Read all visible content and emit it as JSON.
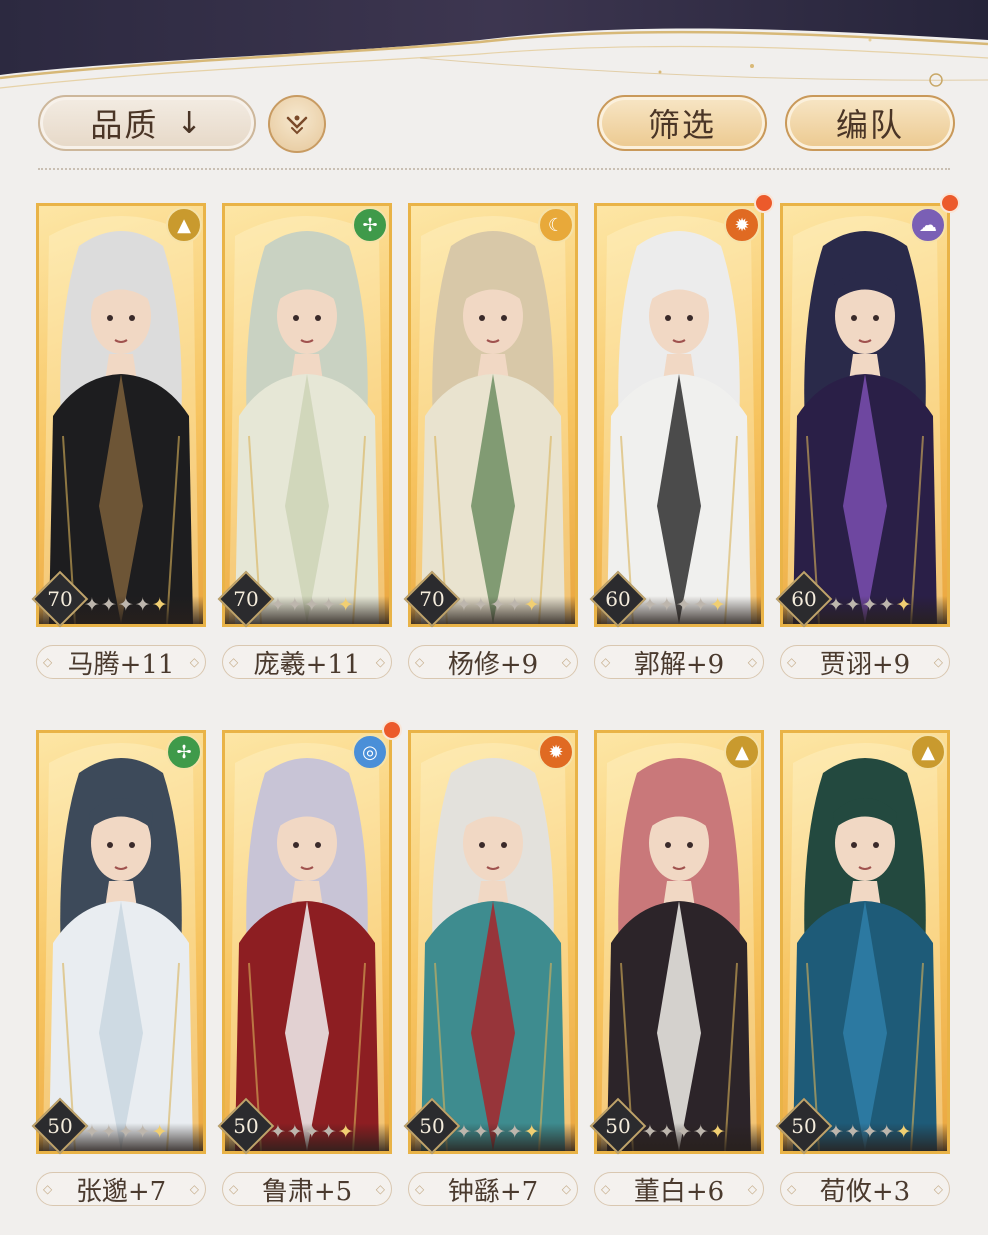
{
  "toolbar": {
    "sort_label": "品质",
    "sort_arrow": "↓",
    "filter_label": "筛选",
    "team_label": "编队"
  },
  "colors": {
    "background": "#f1efed",
    "card_gold": "#f7c460",
    "notification": "#ec5a2b"
  },
  "characters": [
    {
      "name": "马腾+11",
      "level": "70",
      "element": "earth-icon",
      "stars": 5,
      "notify": false
    },
    {
      "name": "庞羲+11",
      "level": "70",
      "element": "wind-icon",
      "stars": 5,
      "notify": false
    },
    {
      "name": "杨修+9",
      "level": "70",
      "element": "moon-icon",
      "stars": 5,
      "notify": false
    },
    {
      "name": "郭解+9",
      "level": "60",
      "element": "fire-icon",
      "stars": 5,
      "notify": true
    },
    {
      "name": "贾诩+9",
      "level": "60",
      "element": "cloud-icon",
      "stars": 5,
      "notify": true
    },
    {
      "name": "张邈+7",
      "level": "50",
      "element": "wind-icon",
      "stars": 5,
      "notify": false
    },
    {
      "name": "鲁肃+5",
      "level": "50",
      "element": "water-icon",
      "stars": 5,
      "notify": true
    },
    {
      "name": "钟繇+7",
      "level": "50",
      "element": "fire-icon",
      "stars": 5,
      "notify": false
    },
    {
      "name": "董白+6",
      "level": "50",
      "element": "earth-icon",
      "stars": 5,
      "notify": false
    },
    {
      "name": "荀攸+3",
      "level": "50",
      "element": "earth-icon",
      "stars": 5,
      "notify": false
    }
  ]
}
